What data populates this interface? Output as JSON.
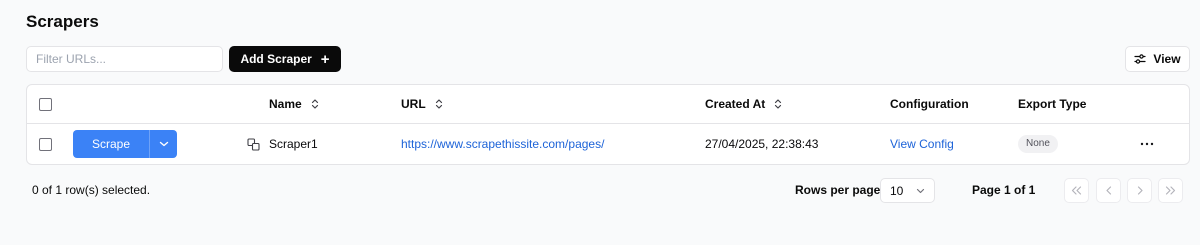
{
  "page": {
    "title": "Scrapers"
  },
  "toolbar": {
    "filter_placeholder": "Filter URLs...",
    "add_label": "Add Scraper",
    "add_icon": "plus-icon",
    "view_label": "View",
    "view_icon": "sliders-icon"
  },
  "table": {
    "headers": {
      "name": "Name",
      "url": "URL",
      "created_at": "Created At",
      "configuration": "Configuration",
      "export_type": "Export Type"
    },
    "rows": [
      {
        "scrape_label": "Scrape",
        "name": "Scraper1",
        "url": "https://www.scrapethissite.com/pages/",
        "created_at": "27/04/2025, 22:38:43",
        "config_link": "View Config",
        "export_type": "None"
      }
    ]
  },
  "footer": {
    "selection": "0 of 1 row(s) selected.",
    "rows_per_page_label": "Rows per page",
    "rows_per_page_value": "10",
    "page_info": "Page 1 of 1"
  },
  "colors": {
    "primary_button": "#3b82f6",
    "link": "#1d63d8",
    "dark_button": "#0a0a0a",
    "background": "#f9fafb"
  }
}
